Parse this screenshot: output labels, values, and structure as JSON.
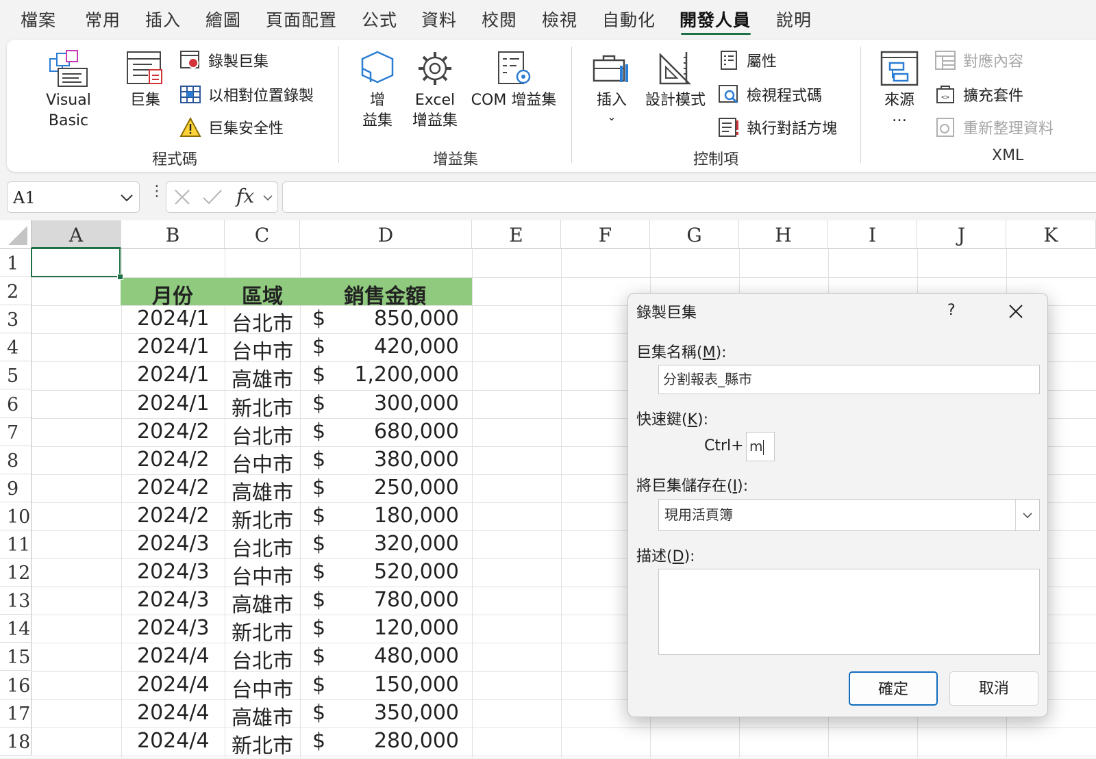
{
  "menu_tabs": [
    "檔案",
    "常用",
    "插入",
    "繪圖",
    "頁面配置",
    "公式",
    "資料",
    "校閱",
    "檢視",
    "自動化",
    "開發人員",
    "說明"
  ],
  "active_tab": "開發人員",
  "ribbon": {
    "code_group": {
      "label": "程式碼",
      "visual_basic": "Visual Basic",
      "macros": "巨集",
      "record_macro": "錄製巨集",
      "relative_ref": "以相對位置錄製",
      "macro_security": "巨集安全性"
    },
    "addins_group": {
      "label": "增益集",
      "addins_line1": "增",
      "addins_line2": "益集",
      "excel_addins_line1": "Excel",
      "excel_addins_line2": "增益集",
      "com_addins": "COM 增益集"
    },
    "controls_group": {
      "label": "控制項",
      "insert": "插入",
      "design_mode": "設計模式",
      "properties": "屬性",
      "view_code": "檢視程式碼",
      "run_dialog": "執行對話方塊"
    },
    "xml_group": {
      "label": "XML",
      "source": "來源",
      "source_more": "…",
      "map_properties": "對應內容",
      "expansion_packs": "擴充套件",
      "refresh_data": "重新整理資料"
    }
  },
  "formula_bar": {
    "name_box": "A1",
    "fx": "fx",
    "formula": ""
  },
  "sheet": {
    "columns": [
      "A",
      "B",
      "C",
      "D",
      "E",
      "F",
      "G",
      "H",
      "I",
      "J",
      "K"
    ],
    "row_numbers": [
      "1",
      "2",
      "3",
      "4",
      "5",
      "6",
      "7",
      "8",
      "9",
      "10",
      "11",
      "12",
      "13",
      "14",
      "15",
      "16",
      "17",
      "18"
    ],
    "selected_cell": "A1",
    "header": {
      "month": "月份",
      "region": "區域",
      "sales": "銷售金額"
    },
    "currency_symbol": "$",
    "rows": [
      {
        "month": "2024/1",
        "region": "台北市",
        "amount": "850,000"
      },
      {
        "month": "2024/1",
        "region": "台中市",
        "amount": "420,000"
      },
      {
        "month": "2024/1",
        "region": "高雄市",
        "amount": "1,200,000"
      },
      {
        "month": "2024/1",
        "region": "新北市",
        "amount": "300,000"
      },
      {
        "month": "2024/2",
        "region": "台北市",
        "amount": "680,000"
      },
      {
        "month": "2024/2",
        "region": "台中市",
        "amount": "380,000"
      },
      {
        "month": "2024/2",
        "region": "高雄市",
        "amount": "250,000"
      },
      {
        "month": "2024/2",
        "region": "新北市",
        "amount": "180,000"
      },
      {
        "month": "2024/3",
        "region": "台北市",
        "amount": "320,000"
      },
      {
        "month": "2024/3",
        "region": "台中市",
        "amount": "520,000"
      },
      {
        "month": "2024/3",
        "region": "高雄市",
        "amount": "780,000"
      },
      {
        "month": "2024/3",
        "region": "新北市",
        "amount": "120,000"
      },
      {
        "month": "2024/4",
        "region": "台北市",
        "amount": "480,000"
      },
      {
        "month": "2024/4",
        "region": "台中市",
        "amount": "150,000"
      },
      {
        "month": "2024/4",
        "region": "高雄市",
        "amount": "350,000"
      },
      {
        "month": "2024/4",
        "region": "新北市",
        "amount": "280,000"
      }
    ],
    "header_fill_color": "#8fca7e"
  },
  "dialog": {
    "title": "錄製巨集",
    "help": "?",
    "macro_name_label": "巨集名稱",
    "macro_name_key": "M",
    "macro_name_value": "分割報表_縣市",
    "shortcut_label": "快速鍵",
    "shortcut_key": "K",
    "ctrl_prefix": "Ctrl+",
    "shortcut_value": "m",
    "store_in_label": "將巨集儲存在",
    "store_in_key": "I",
    "store_in_value": "現用活頁簿",
    "description_label": "描述",
    "description_key": "D",
    "description_value": "",
    "ok": "確定",
    "cancel": "取消"
  }
}
